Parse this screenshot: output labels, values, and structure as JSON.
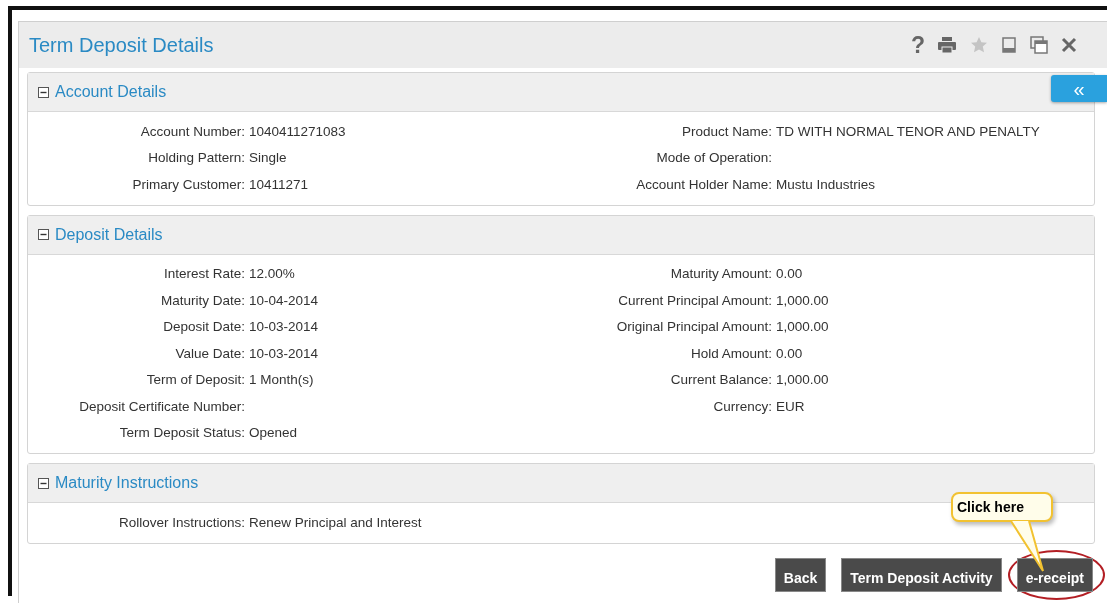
{
  "window": {
    "title": "Term Deposit Details",
    "help_label": "?",
    "collapse_label": "«"
  },
  "sections": [
    {
      "title": "Account Details",
      "expanded": true,
      "left": [
        {
          "label": "Account Number:",
          "value": "1040411271083"
        },
        {
          "label": "Holding Pattern:",
          "value": "Single"
        },
        {
          "label": "Primary Customer:",
          "value": "10411271"
        }
      ],
      "right": [
        {
          "label": "Product Name:",
          "value": "TD WITH NORMAL TENOR AND PENALTY"
        },
        {
          "label": "Mode of Operation:"
        },
        {
          "label": "Account Holder Name:",
          "value": "Mustu Industries"
        }
      ]
    },
    {
      "title": "Deposit Details",
      "expanded": true,
      "left": [
        {
          "label": "Interest Rate:",
          "value": "12.00%"
        },
        {
          "label": "Maturity Date:",
          "value": "10-04-2014"
        },
        {
          "label": "Deposit Date:",
          "value": "10-03-2014"
        },
        {
          "label": "Value Date:",
          "value": "10-03-2014"
        },
        {
          "label": "Term of Deposit:",
          "value": "1 Month(s)"
        },
        {
          "label": "Deposit Certificate Number:"
        },
        {
          "label": "Term Deposit Status:",
          "value": "Opened"
        }
      ],
      "right": [
        {
          "label": "Maturity Amount:",
          "value": "0.00"
        },
        {
          "label": "Current Principal Amount:",
          "value": "1,000.00"
        },
        {
          "label": "Original Principal Amount:",
          "value": "1,000.00"
        },
        {
          "label": "Hold Amount:",
          "value": "0.00"
        },
        {
          "label": "Current Balance:",
          "value": "1,000.00"
        },
        {
          "label": "Currency:",
          "value": "EUR"
        }
      ]
    },
    {
      "title": "Maturity Instructions",
      "expanded": true,
      "left": [
        {
          "label": "Rollover Instructions:",
          "value": "Renew Principal and Interest"
        }
      ]
    }
  ],
  "buttons": [
    {
      "label": "Back",
      "highlighted": false
    },
    {
      "label": "Term Deposit Activity",
      "highlighted": false
    },
    {
      "label": "e-receipt",
      "highlighted": true
    }
  ],
  "callout": {
    "text": "Click here"
  }
}
